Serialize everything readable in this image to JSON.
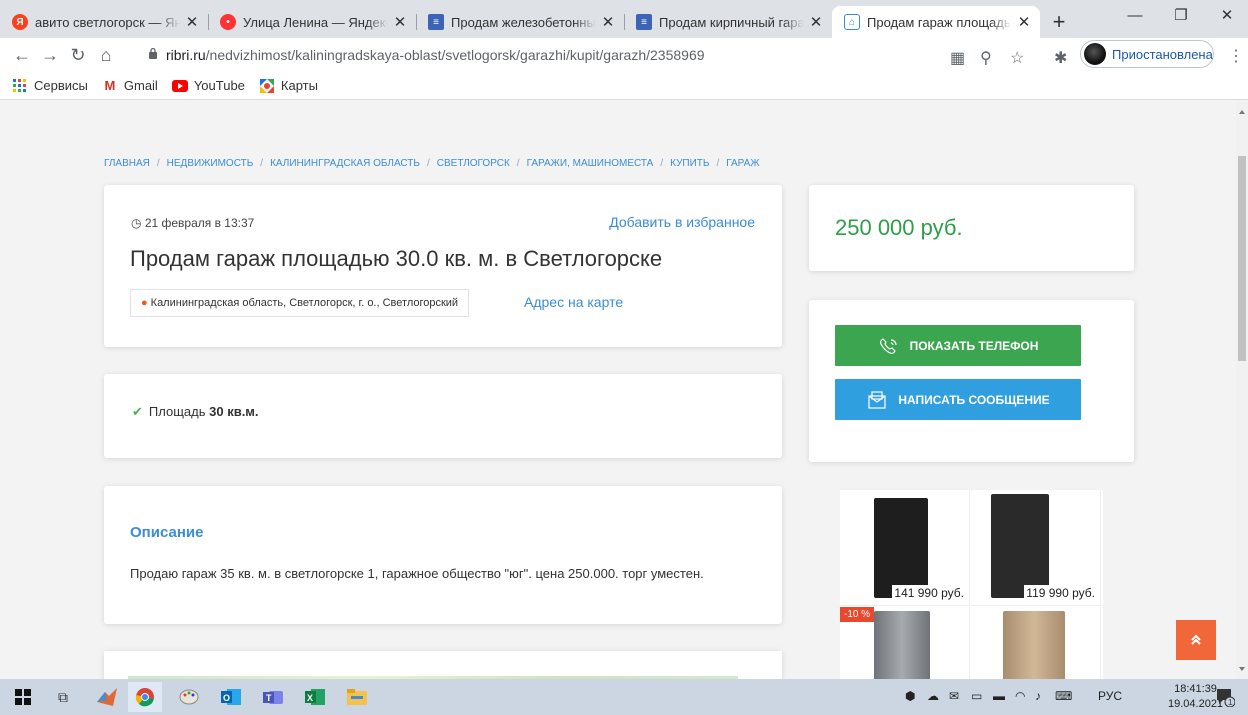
{
  "browser": {
    "tabs": [
      {
        "title": "авито светлогорск — Яндекс",
        "icon": "yandex-icon",
        "active": false
      },
      {
        "title": "Улица Ленина — Яндекс.Карты",
        "icon": "maps-pin-icon",
        "active": false
      },
      {
        "title": "Продам железобетонный гараж",
        "icon": "doc-icon",
        "active": false
      },
      {
        "title": "Продам кирпичный гараж",
        "icon": "doc-icon",
        "active": false
      },
      {
        "title": "Продам гараж площадью",
        "icon": "ribri-icon",
        "active": true
      }
    ],
    "new_tab": "+",
    "url_host": "ribri.ru",
    "url_path": "/nedvizhimost/kaliningradskaya-oblast/svetlogorsk/garazhi/kupit/garazh/2358969",
    "profile_label": "Приостановлена",
    "bookmarks": [
      {
        "label": "Сервисы",
        "icon": "apps-grid-icon"
      },
      {
        "label": "Gmail",
        "icon": "gmail-icon"
      },
      {
        "label": "YouTube",
        "icon": "youtube-icon"
      },
      {
        "label": "Карты",
        "icon": "maps-icon"
      }
    ]
  },
  "page": {
    "breadcrumbs": [
      "ГЛАВНАЯ",
      "НЕДВИЖИМОСТЬ",
      "КАЛИНИНГРАДСКАЯ ОБЛАСТЬ",
      "СВЕТЛОГОРСК",
      "ГАРАЖИ, МАШИНОМЕСТА",
      "КУПИТЬ",
      "ГАРАЖ"
    ],
    "date": "21 февраля в 13:37",
    "add_favorite": "Добавить в избранное",
    "title": "Продам гараж площадью 30.0 кв. м. в Светлогорске",
    "address": "Калининградская область, Светлогорск, г. о., Светлогорский",
    "map_link": "Адрес на карте",
    "feature_label": "Площадь",
    "feature_value": "30 кв.м.",
    "description_heading": "Описание",
    "description_text": "Продаю гараж 35 кв. м. в светлогорске 1, гаражное общество \"юг\". цена 250.000. торг уместен.",
    "price": "250 000 руб.",
    "show_phone": "ПОКАЗАТЬ ТЕЛЕФОН",
    "write_message": "НАПИСАТЬ СООБЩЕНИЕ",
    "products": [
      {
        "price": "141 990 руб.",
        "color": "#1e1e1e"
      },
      {
        "price": "119 990 руб.",
        "color": "#2a2a2a"
      },
      {
        "badge": "-10 %",
        "color": "#8c8f94"
      },
      {
        "color": "#b89a78"
      }
    ],
    "scroll_top": "»"
  },
  "taskbar": {
    "language": "РУС",
    "time": "18:41:39",
    "date": "19.04.2021",
    "notification_count": "1"
  },
  "colors": {
    "link": "#3a8dd6",
    "price": "#2e9e48",
    "phone_button": "#3ba64f",
    "message_button": "#2f9fdf",
    "scroll_top": "#f0683a"
  }
}
